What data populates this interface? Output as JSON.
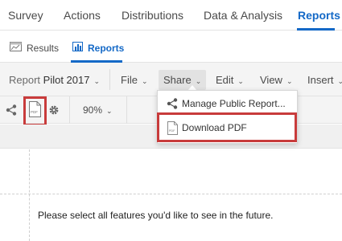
{
  "topnav": {
    "tabs": [
      {
        "label": "Survey"
      },
      {
        "label": "Actions"
      },
      {
        "label": "Distributions"
      },
      {
        "label": "Data & Analysis"
      },
      {
        "label": "Reports"
      }
    ],
    "active": "Reports"
  },
  "subnav": {
    "results_label": "Results",
    "reports_label": "Reports"
  },
  "menubar": {
    "report_prefix": "Report",
    "report_name": "Pilot 2017",
    "file_label": "File",
    "share_label": "Share",
    "edit_label": "Edit",
    "view_label": "View",
    "insert_label": "Insert"
  },
  "toolbar": {
    "zoom_value": "90%"
  },
  "share_menu": {
    "items": [
      {
        "label": "Manage Public Report..."
      },
      {
        "label": "Download PDF"
      }
    ]
  },
  "content": {
    "question_text": "Please select all features you'd like to see in the future."
  },
  "colors": {
    "accent": "#1469c7",
    "highlight": "#c83b3b"
  }
}
